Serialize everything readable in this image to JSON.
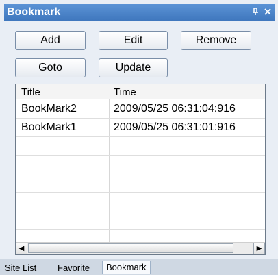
{
  "window": {
    "title": "Bookmark",
    "pin_icon": "pin-icon",
    "close_icon": "close-icon"
  },
  "toolbar": {
    "add_label": "Add",
    "edit_label": "Edit",
    "remove_label": "Remove",
    "goto_label": "Goto",
    "update_label": "Update"
  },
  "table": {
    "columns": [
      "Title",
      "Time"
    ],
    "rows": [
      {
        "title": "BookMark2",
        "time": "2009/05/25 06:31:04:916"
      },
      {
        "title": "BookMark1",
        "time": "2009/05/25 06:31:01:916"
      }
    ]
  },
  "tabs": [
    {
      "label": "Site List"
    },
    {
      "label": "Favorite"
    },
    {
      "label": "Bookmark",
      "active": true
    }
  ]
}
